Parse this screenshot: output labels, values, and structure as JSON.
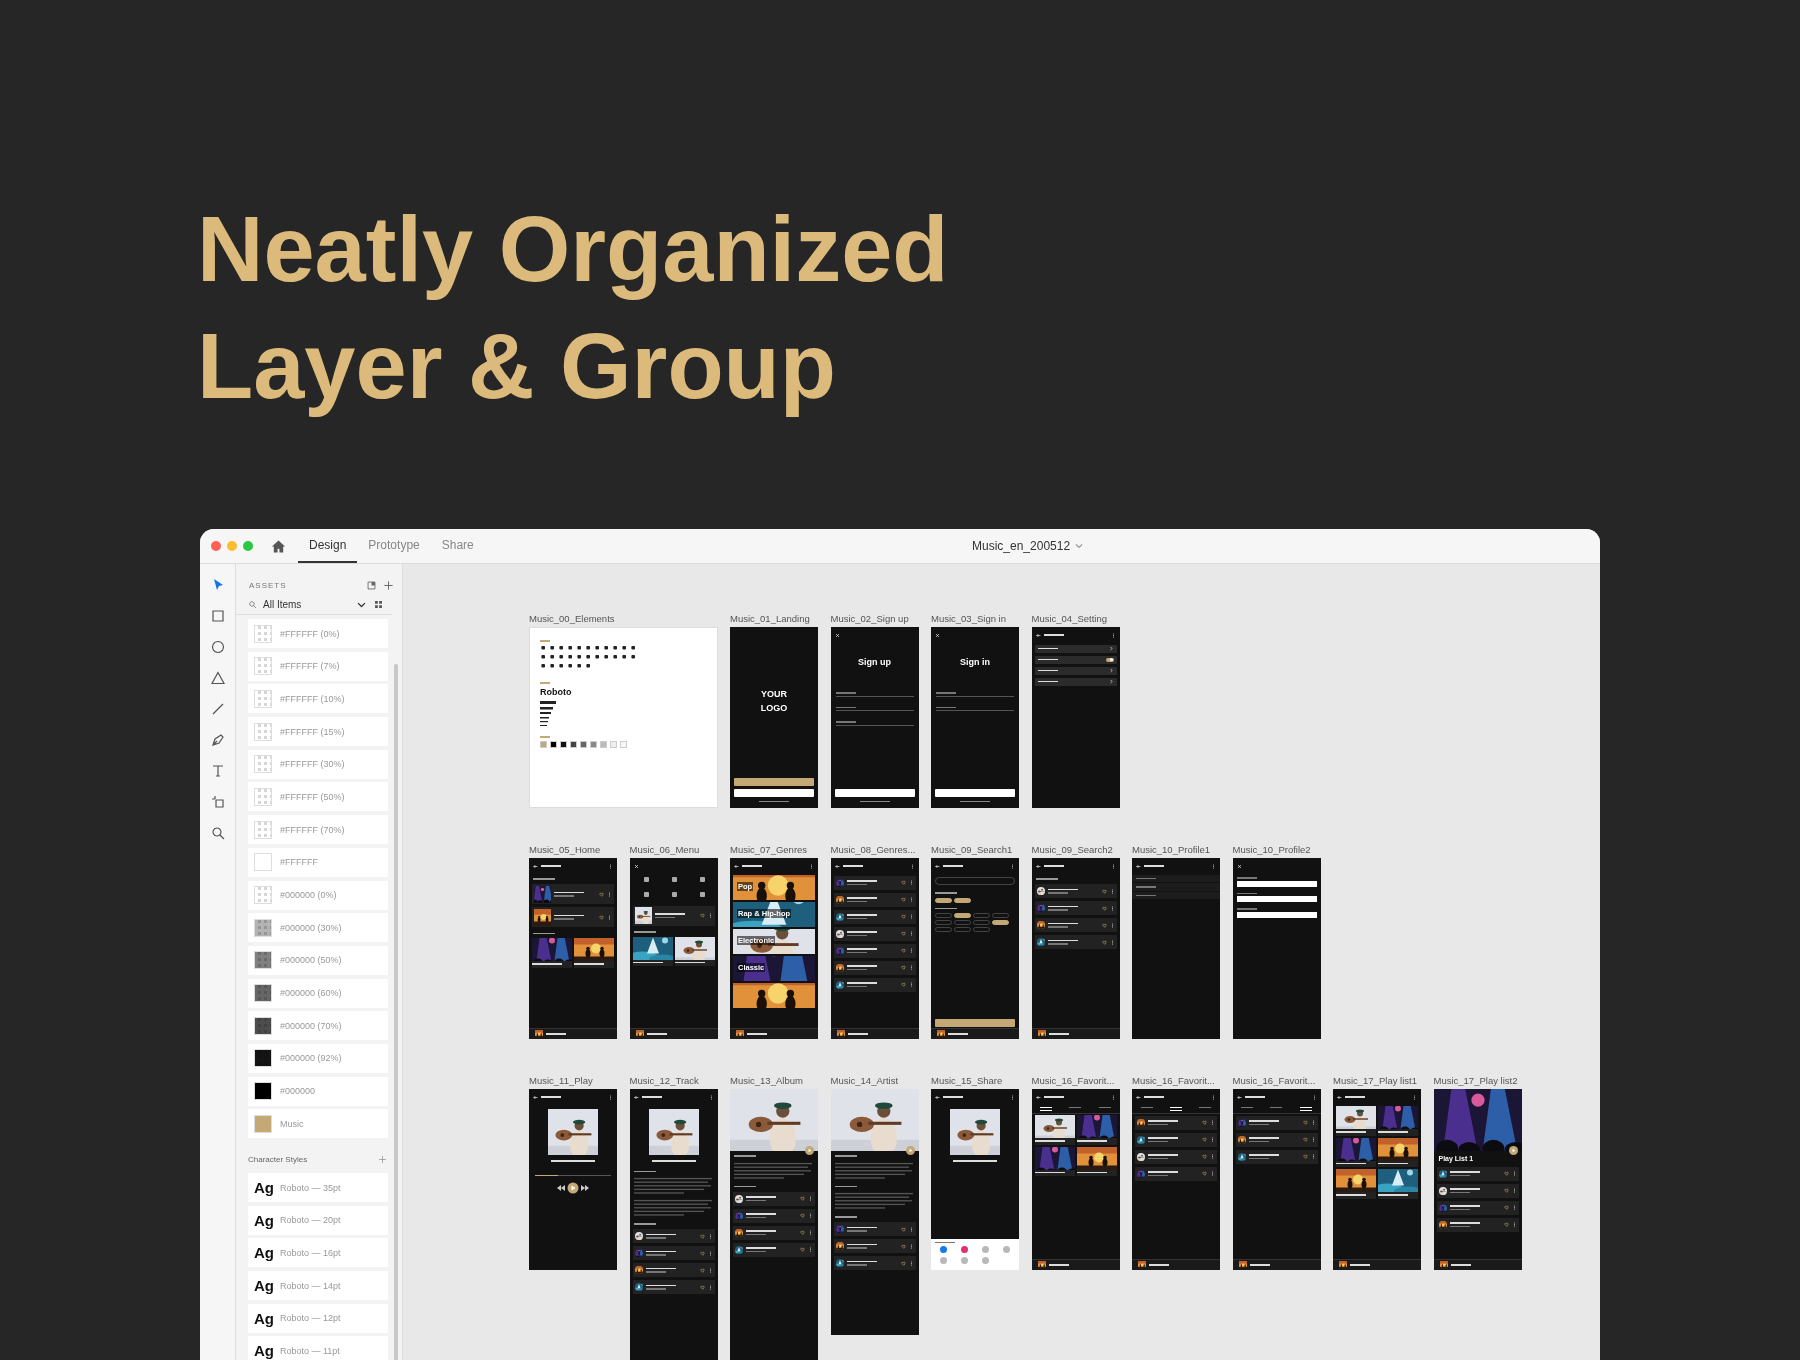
{
  "headline": {
    "lines": [
      "Neatly Organized",
      "Layer & Group"
    ]
  },
  "window": {
    "title": "Music_en_200512",
    "tabs": [
      {
        "label": "Design",
        "selected": true
      },
      {
        "label": "Prototype",
        "selected": false
      },
      {
        "label": "Share",
        "selected": false
      }
    ]
  },
  "tools": [
    {
      "kind": "select",
      "selected": true
    },
    {
      "kind": "rectangle",
      "selected": false
    },
    {
      "kind": "ellipse",
      "selected": false
    },
    {
      "kind": "triangle",
      "selected": false
    },
    {
      "kind": "line",
      "selected": false
    },
    {
      "kind": "pen",
      "selected": false
    },
    {
      "kind": "text",
      "selected": false
    },
    {
      "kind": "artboard",
      "selected": false
    },
    {
      "kind": "zoom",
      "selected": false
    }
  ],
  "assets": {
    "heading": "ASSETS",
    "filter": "All Items",
    "colors": [
      {
        "label": "#FFFFFF (0%)",
        "kind": "checker",
        "color": "#ffffff"
      },
      {
        "label": "#FFFFFF (7%)",
        "kind": "checker",
        "color": "#ffffff"
      },
      {
        "label": "#FFFFFF (10%)",
        "kind": "checker",
        "color": "#ffffff"
      },
      {
        "label": "#FFFFFF (15%)",
        "kind": "checker",
        "color": "#ffffff"
      },
      {
        "label": "#FFFFFF (30%)",
        "kind": "checker",
        "color": "#ffffff"
      },
      {
        "label": "#FFFFFF (50%)",
        "kind": "checker",
        "color": "#ffffff"
      },
      {
        "label": "#FFFFFF (70%)",
        "kind": "checker",
        "color": "#ffffff"
      },
      {
        "label": "#FFFFFF",
        "kind": "solid",
        "color": "#ffffff"
      },
      {
        "label": "#000000 (0%)",
        "kind": "checker",
        "color": "#ffffff"
      },
      {
        "label": "#000000 (30%)",
        "kind": "checker",
        "color": "#b3b3b3"
      },
      {
        "label": "#000000 (50%)",
        "kind": "checker",
        "color": "#808080"
      },
      {
        "label": "#000000 (60%)",
        "kind": "checker",
        "color": "#666666"
      },
      {
        "label": "#000000 (70%)",
        "kind": "checker",
        "color": "#4d4d4d"
      },
      {
        "label": "#000000 (92%)",
        "kind": "checker",
        "color": "#141414"
      },
      {
        "label": "#000000",
        "kind": "solid",
        "color": "#000000"
      },
      {
        "label": "Music",
        "kind": "solid",
        "color": "#c4a875"
      }
    ],
    "character_styles": {
      "heading": "Character Styles",
      "items": [
        {
          "sample": "Ag",
          "label": "Roboto — 35pt"
        },
        {
          "sample": "Ag",
          "label": "Roboto — 20pt"
        },
        {
          "sample": "Ag",
          "label": "Roboto — 16pt"
        },
        {
          "sample": "Ag",
          "label": "Roboto — 14pt"
        },
        {
          "sample": "Ag",
          "label": "Roboto — 12pt"
        },
        {
          "sample": "Ag",
          "label": "Roboto — 11pt"
        }
      ]
    }
  },
  "canvas": {
    "rows": [
      {
        "artboards": [
          {
            "name": "Music_00_Elements",
            "kind": "elements",
            "font_sample": "Roboto",
            "swatches": [
              {
                "color": "#c4a875"
              },
              {
                "color": "#000000"
              },
              {
                "color": "#111111"
              },
              {
                "color": "#444444"
              },
              {
                "color": "#666666"
              },
              {
                "color": "#888888"
              },
              {
                "color": "#bbbbbb"
              },
              {
                "color": "#eeeeee"
              },
              {
                "color": "#f7f7f7"
              }
            ]
          },
          {
            "name": "Music_01_Landing",
            "kind": "screen",
            "blocks": [
              {
                "kind": "spacer"
              },
              {
                "kind": "logo",
                "text": "YOUR LOGO"
              },
              {
                "kind": "spacer"
              },
              {
                "kind": "accent-button"
              },
              {
                "kind": "button"
              },
              {
                "kind": "note"
              }
            ]
          },
          {
            "name": "Music_02_Sign up",
            "kind": "screen",
            "blocks": [
              {
                "kind": "close-header"
              },
              {
                "kind": "title",
                "text": "Sign up"
              },
              {
                "kind": "field"
              },
              {
                "kind": "field"
              },
              {
                "kind": "field"
              },
              {
                "kind": "spacer"
              },
              {
                "kind": "button"
              },
              {
                "kind": "note"
              }
            ]
          },
          {
            "name": "Music_03_Sign in",
            "kind": "screen",
            "blocks": [
              {
                "kind": "close-header"
              },
              {
                "kind": "title",
                "text": "Sign in"
              },
              {
                "kind": "field"
              },
              {
                "kind": "field"
              },
              {
                "kind": "spacer"
              },
              {
                "kind": "button"
              },
              {
                "kind": "note"
              }
            ]
          },
          {
            "name": "Music_04_Setting",
            "kind": "screen",
            "blocks": [
              {
                "kind": "header"
              },
              {
                "kind": "setting"
              },
              {
                "kind": "toggle-setting",
                "on": true
              },
              {
                "kind": "setting"
              },
              {
                "kind": "setting"
              }
            ]
          }
        ]
      },
      {
        "artboards": [
          {
            "name": "Music_05_Home",
            "kind": "screen",
            "blocks": [
              {
                "kind": "header"
              },
              {
                "kind": "section"
              },
              {
                "kind": "card"
              },
              {
                "kind": "card"
              },
              {
                "kind": "section"
              },
              {
                "kind": "tile-row"
              },
              {
                "kind": "spacer"
              },
              {
                "kind": "player"
              }
            ]
          },
          {
            "name": "Music_06_Menu",
            "kind": "screen",
            "blocks": [
              {
                "kind": "close-header"
              },
              {
                "kind": "icon-grid"
              },
              {
                "kind": "card"
              },
              {
                "kind": "section"
              },
              {
                "kind": "tile-row"
              },
              {
                "kind": "spacer"
              },
              {
                "kind": "player"
              }
            ]
          },
          {
            "name": "Music_07_Genres",
            "kind": "screen",
            "blocks": [
              {
                "kind": "header"
              },
              {
                "kind": "banner",
                "title": "Pop"
              },
              {
                "kind": "banner",
                "title": "Rap & Hip-hop"
              },
              {
                "kind": "banner",
                "title": "Electronic"
              },
              {
                "kind": "banner",
                "title": "Classic"
              },
              {
                "kind": "banner"
              },
              {
                "kind": "spacer"
              },
              {
                "kind": "player"
              }
            ]
          },
          {
            "name": "Music_08_Genres...",
            "kind": "screen",
            "blocks": [
              {
                "kind": "header"
              },
              {
                "kind": "row"
              },
              {
                "kind": "row"
              },
              {
                "kind": "row"
              },
              {
                "kind": "row"
              },
              {
                "kind": "row"
              },
              {
                "kind": "row"
              },
              {
                "kind": "row"
              },
              {
                "kind": "spacer"
              },
              {
                "kind": "player"
              }
            ]
          },
          {
            "name": "Music_09_Search1",
            "kind": "screen",
            "blocks": [
              {
                "kind": "header"
              },
              {
                "kind": "search"
              },
              {
                "kind": "section"
              },
              {
                "kind": "chips",
                "items": [
                  {
                    "selected": true
                  },
                  {
                    "selected": true
                  }
                ]
              },
              {
                "kind": "section"
              },
              {
                "kind": "chips",
                "items": [
                  {
                    "selected": false
                  },
                  {
                    "selected": true
                  },
                  {
                    "selected": false
                  },
                  {
                    "selected": false
                  },
                  {
                    "selected": false
                  },
                  {
                    "selected": false
                  },
                  {
                    "selected": false
                  },
                  {
                    "selected": true
                  },
                  {
                    "selected": false
                  },
                  {
                    "selected": false
                  },
                  {
                    "selected": false
                  }
                ]
              },
              {
                "kind": "spacer"
              },
              {
                "kind": "accent-button"
              },
              {
                "kind": "player"
              }
            ]
          },
          {
            "name": "Music_09_Search2",
            "kind": "screen",
            "blocks": [
              {
                "kind": "header"
              },
              {
                "kind": "section"
              },
              {
                "kind": "row"
              },
              {
                "kind": "row"
              },
              {
                "kind": "row"
              },
              {
                "kind": "row"
              },
              {
                "kind": "spacer"
              },
              {
                "kind": "player"
              }
            ]
          },
          {
            "name": "Music_10_Profile1",
            "kind": "screen",
            "blocks": [
              {
                "kind": "header"
              },
              {
                "kind": "info"
              },
              {
                "kind": "info"
              },
              {
                "kind": "info"
              }
            ]
          },
          {
            "name": "Music_10_Profile2",
            "kind": "screen",
            "blocks": [
              {
                "kind": "close-header"
              },
              {
                "kind": "input"
              },
              {
                "kind": "input"
              },
              {
                "kind": "input"
              }
            ]
          }
        ]
      },
      {
        "artboards": [
          {
            "name": "Music_11_Play",
            "kind": "screen",
            "blocks": [
              {
                "kind": "header"
              },
              {
                "kind": "cover"
              },
              {
                "kind": "caption"
              },
              {
                "kind": "playback",
                "level": 0.3
              }
            ]
          },
          {
            "name": "Music_12_Track",
            "kind": "screen",
            "blocks": [
              {
                "kind": "header"
              },
              {
                "kind": "cover"
              },
              {
                "kind": "caption"
              },
              {
                "kind": "section"
              },
              {
                "kind": "paragraph"
              },
              {
                "kind": "paragraph"
              },
              {
                "kind": "section"
              },
              {
                "kind": "row"
              },
              {
                "kind": "row"
              },
              {
                "kind": "row"
              },
              {
                "kind": "row"
              }
            ]
          },
          {
            "name": "Music_13_Album",
            "kind": "screen",
            "blocks": [
              {
                "kind": "hero"
              },
              {
                "kind": "section"
              },
              {
                "kind": "paragraph"
              },
              {
                "kind": "section"
              },
              {
                "kind": "row"
              },
              {
                "kind": "row"
              },
              {
                "kind": "row"
              },
              {
                "kind": "row"
              }
            ]
          },
          {
            "name": "Music_14_Artist",
            "kind": "screen",
            "blocks": [
              {
                "kind": "hero"
              },
              {
                "kind": "section"
              },
              {
                "kind": "paragraph"
              },
              {
                "kind": "section"
              },
              {
                "kind": "paragraph"
              },
              {
                "kind": "section"
              },
              {
                "kind": "row"
              },
              {
                "kind": "row"
              },
              {
                "kind": "row"
              }
            ]
          },
          {
            "name": "Music_15_Share",
            "kind": "screen",
            "blocks": [
              {
                "kind": "header"
              },
              {
                "kind": "cover"
              },
              {
                "kind": "caption"
              },
              {
                "kind": "spacer"
              },
              {
                "kind": "sheet",
                "targets": [
                  {
                    "color": "#1877f2"
                  },
                  {
                    "color": "#e1306c"
                  },
                  {
                    "color": "#b8b8b8"
                  },
                  {
                    "color": "#b8b8b8"
                  },
                  {
                    "color": "#b8b8b8"
                  },
                  {
                    "color": "#b8b8b8"
                  },
                  {
                    "color": "#b8b8b8"
                  }
                ]
              }
            ]
          },
          {
            "name": "Music_16_Favorit...",
            "kind": "screen",
            "blocks": [
              {
                "kind": "header"
              },
              {
                "kind": "tabs",
                "items": [
                  {
                    "selected": true
                  },
                  {
                    "selected": false
                  },
                  {
                    "selected": false
                  }
                ]
              },
              {
                "kind": "tile-row"
              },
              {
                "kind": "tile-row"
              },
              {
                "kind": "spacer"
              },
              {
                "kind": "player"
              }
            ]
          },
          {
            "name": "Music_16_Favorit...",
            "kind": "screen",
            "blocks": [
              {
                "kind": "header"
              },
              {
                "kind": "tabs",
                "items": [
                  {
                    "selected": false
                  },
                  {
                    "selected": true
                  },
                  {
                    "selected": false
                  }
                ]
              },
              {
                "kind": "row"
              },
              {
                "kind": "row"
              },
              {
                "kind": "row"
              },
              {
                "kind": "row"
              },
              {
                "kind": "spacer"
              },
              {
                "kind": "player"
              }
            ]
          },
          {
            "name": "Music_16_Favorit...",
            "kind": "screen",
            "blocks": [
              {
                "kind": "header"
              },
              {
                "kind": "tabs",
                "items": [
                  {
                    "selected": false
                  },
                  {
                    "selected": false
                  },
                  {
                    "selected": true
                  }
                ]
              },
              {
                "kind": "row"
              },
              {
                "kind": "row"
              },
              {
                "kind": "row"
              },
              {
                "kind": "spacer"
              },
              {
                "kind": "player"
              }
            ]
          },
          {
            "name": "Music_17_Play list1",
            "kind": "screen",
            "blocks": [
              {
                "kind": "header"
              },
              {
                "kind": "tile-row"
              },
              {
                "kind": "tile-row"
              },
              {
                "kind": "tile-row"
              },
              {
                "kind": "spacer"
              },
              {
                "kind": "player"
              }
            ]
          },
          {
            "name": "Music_17_Play list2",
            "kind": "screen",
            "blocks": [
              {
                "kind": "hero"
              },
              {
                "kind": "heading",
                "text": "Play List 1"
              },
              {
                "kind": "row"
              },
              {
                "kind": "row"
              },
              {
                "kind": "row"
              },
              {
                "kind": "row"
              },
              {
                "kind": "spacer"
              },
              {
                "kind": "player"
              }
            ]
          }
        ]
      }
    ]
  }
}
